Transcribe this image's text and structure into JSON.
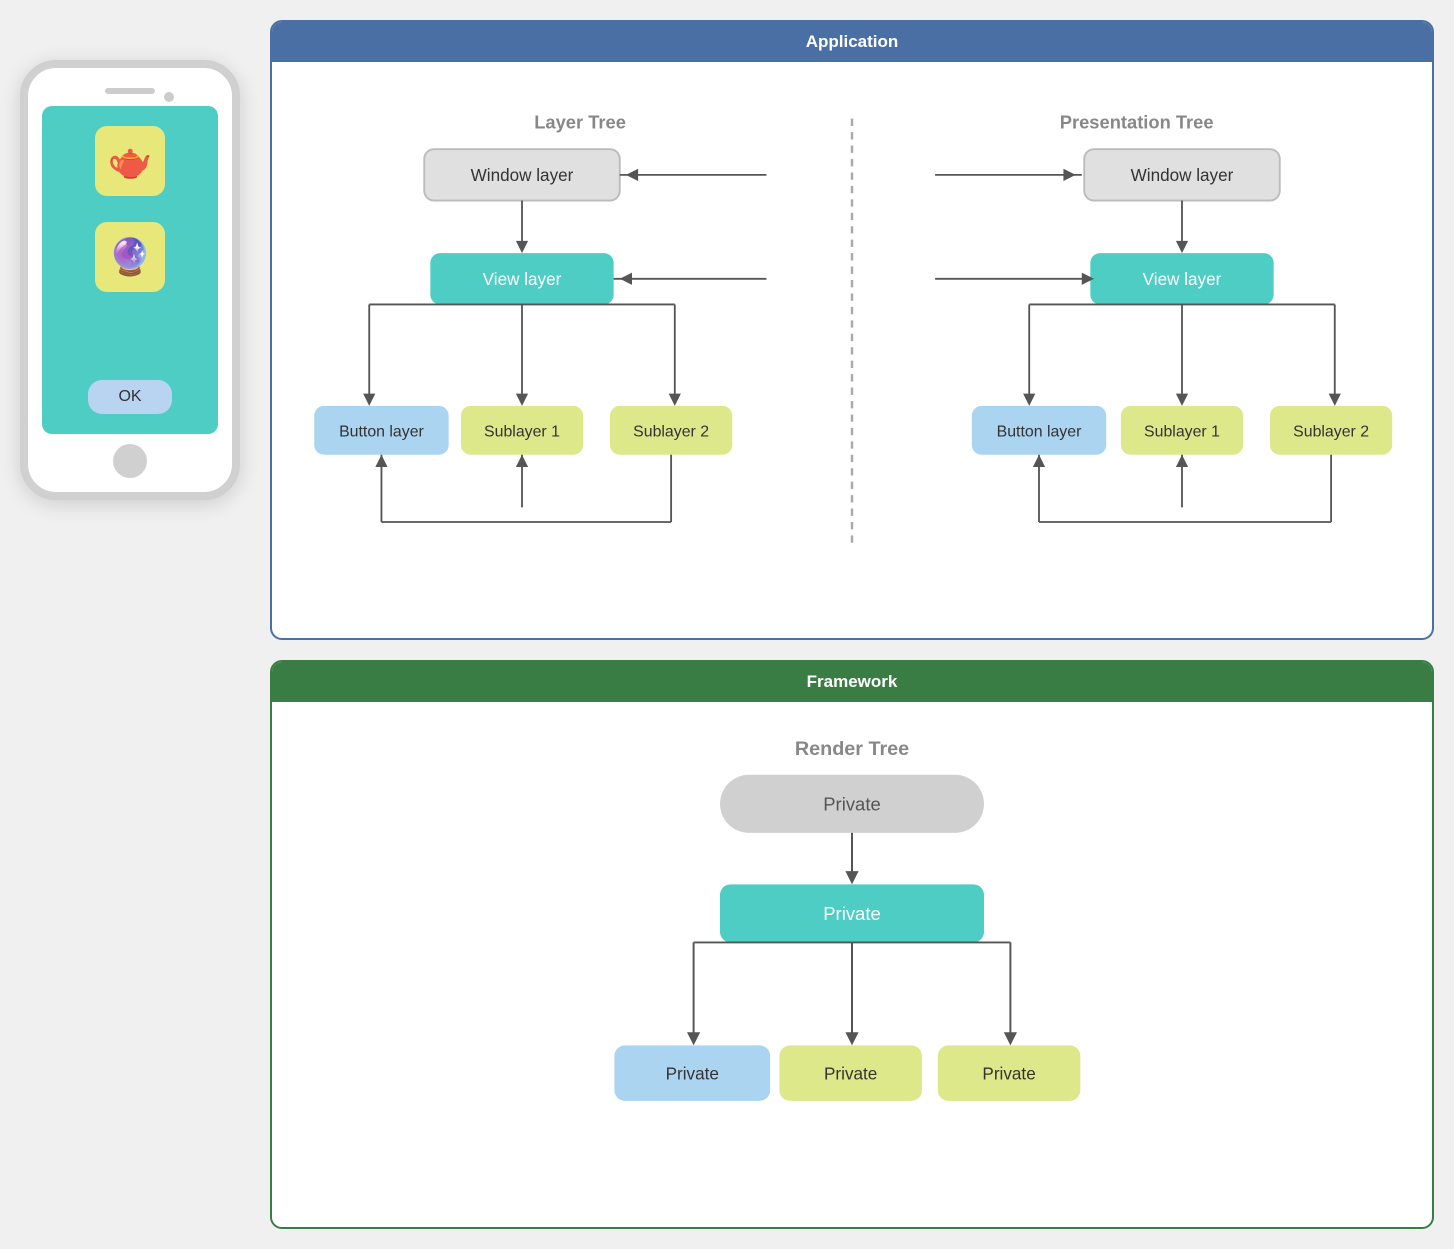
{
  "phone": {
    "ok_label": "OK",
    "teapot_emoji": "🫖",
    "gem_emoji": "🔮"
  },
  "application": {
    "title": "Application",
    "layer_tree_label": "Layer Tree",
    "presentation_tree_label": "Presentation Tree",
    "window_layer": "Window layer",
    "view_layer": "View layer",
    "button_layer": "Button layer",
    "sublayer1": "Sublayer 1",
    "sublayer2": "Sublayer 2"
  },
  "framework": {
    "title": "Framework",
    "render_tree_label": "Render Tree",
    "private": "Private"
  }
}
